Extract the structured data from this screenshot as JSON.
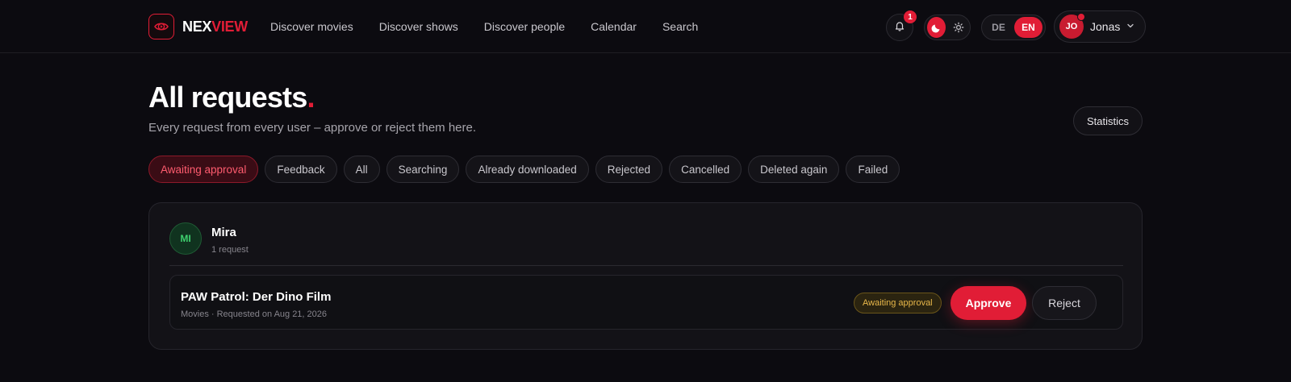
{
  "brand": {
    "name_part1": "NEX",
    "name_part2": "VIEW",
    "accent": "#e11d36"
  },
  "nav": {
    "items": [
      {
        "label": "Discover movies"
      },
      {
        "label": "Discover shows"
      },
      {
        "label": "Discover people"
      },
      {
        "label": "Calendar"
      },
      {
        "label": "Search"
      }
    ]
  },
  "header": {
    "notifications_count": "1",
    "theme": {
      "icons": [
        "moon-icon",
        "sun-icon"
      ],
      "active": "dark"
    },
    "languages": [
      "DE",
      "EN"
    ],
    "active_language": "EN",
    "user": {
      "initials": "JO",
      "name": "Jonas"
    }
  },
  "page": {
    "title": "All requests",
    "title_dot": ".",
    "subtitle": "Every request from every user – approve or reject them here.",
    "statistics_label": "Statistics"
  },
  "filters": [
    {
      "label": "Awaiting approval",
      "active": true
    },
    {
      "label": "Feedback"
    },
    {
      "label": "All"
    },
    {
      "label": "Searching"
    },
    {
      "label": "Already downloaded"
    },
    {
      "label": "Rejected"
    },
    {
      "label": "Cancelled"
    },
    {
      "label": "Deleted again"
    },
    {
      "label": "Failed"
    }
  ],
  "group": {
    "user": {
      "initials": "MI",
      "name": "Mira",
      "count_label": "1 request"
    },
    "requests": [
      {
        "title": "PAW Patrol: Der Dino Film",
        "meta": "Movies · Requested on Aug 21, 2026",
        "status": "Awaiting approval",
        "approve_label": "Approve",
        "reject_label": "Reject"
      }
    ]
  }
}
